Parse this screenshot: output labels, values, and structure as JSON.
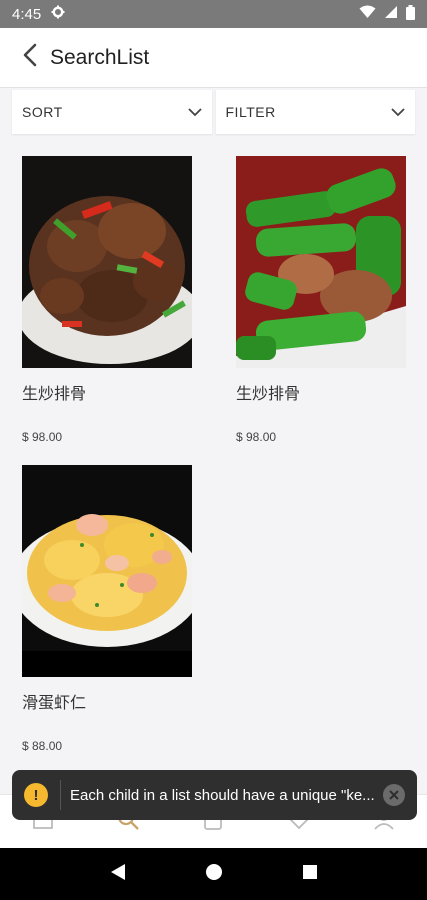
{
  "status_bar": {
    "time": "4:45"
  },
  "header": {
    "title": "SearchList"
  },
  "controls": {
    "sort_label": "SORT",
    "filter_label": "FILTER"
  },
  "products": [
    {
      "name": "生炒排骨",
      "price": "$ 98.00"
    },
    {
      "name": "生炒排骨",
      "price": "$ 98.00"
    },
    {
      "name": "滑蛋虾仁",
      "price": "$ 88.00"
    }
  ],
  "toast": {
    "message": "Each child in a list should have a unique \"ke..."
  },
  "tabbar": {
    "icons": [
      "home-icon",
      "search-icon",
      "bag-icon",
      "heart-icon",
      "profile-icon"
    ],
    "active_color": "#c8a46b"
  },
  "colors": {
    "status_bar": "#7a7a7a",
    "toast_bg": "#2f2f2f",
    "warning": "#f5b82e"
  }
}
